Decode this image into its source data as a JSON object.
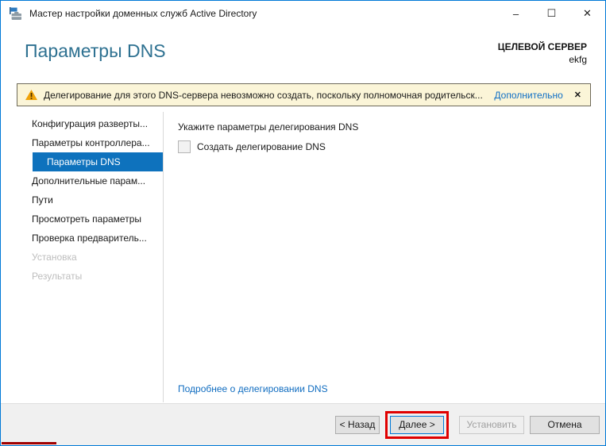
{
  "window": {
    "title": "Мастер настройки доменных служб Active Directory"
  },
  "titlebar": {
    "minimize_glyph": "–",
    "maximize_glyph": "☐",
    "close_glyph": "✕"
  },
  "header": {
    "title": "Параметры DNS",
    "target_label": "ЦЕЛЕВОЙ СЕРВЕР",
    "target_server": "ekfg"
  },
  "warning": {
    "message": "Делегирование для этого DNS-сервера невозможно создать, поскольку полномочная родительск...",
    "action_label": "Дополнительно",
    "close_glyph": "✕"
  },
  "sidebar": {
    "items": [
      {
        "label": "Конфигурация разверты...",
        "state": "normal"
      },
      {
        "label": "Параметры контроллера...",
        "state": "normal"
      },
      {
        "label": "Параметры DNS",
        "state": "selected"
      },
      {
        "label": "Дополнительные парам...",
        "state": "normal"
      },
      {
        "label": "Пути",
        "state": "normal"
      },
      {
        "label": "Просмотреть параметры",
        "state": "normal"
      },
      {
        "label": "Проверка предваритель...",
        "state": "normal"
      },
      {
        "label": "Установка",
        "state": "disabled"
      },
      {
        "label": "Результаты",
        "state": "disabled"
      }
    ]
  },
  "content": {
    "instruction": "Укажите параметры делегирования DNS",
    "checkbox_label": "Создать делегирование DNS",
    "checkbox_checked": false,
    "checkbox_enabled": false,
    "link": "Подробнее о делегировании DNS"
  },
  "footer": {
    "back_label": "< Назад",
    "next_label": "Далее >",
    "install_label": "Установить",
    "cancel_label": "Отмена"
  },
  "colors": {
    "window_border": "#0079d7",
    "header_title": "#2e7191",
    "selected_nav_bg": "#0e72bd",
    "warning_bg": "#fbf5d8",
    "warning_border": "#6e6a5a",
    "warning_icon": "#f0a30a",
    "link": "#0f6cc0",
    "default_button_border": "#0078d7",
    "annotation_red": "#e00000",
    "footer_bg": "#f0f0f0"
  }
}
